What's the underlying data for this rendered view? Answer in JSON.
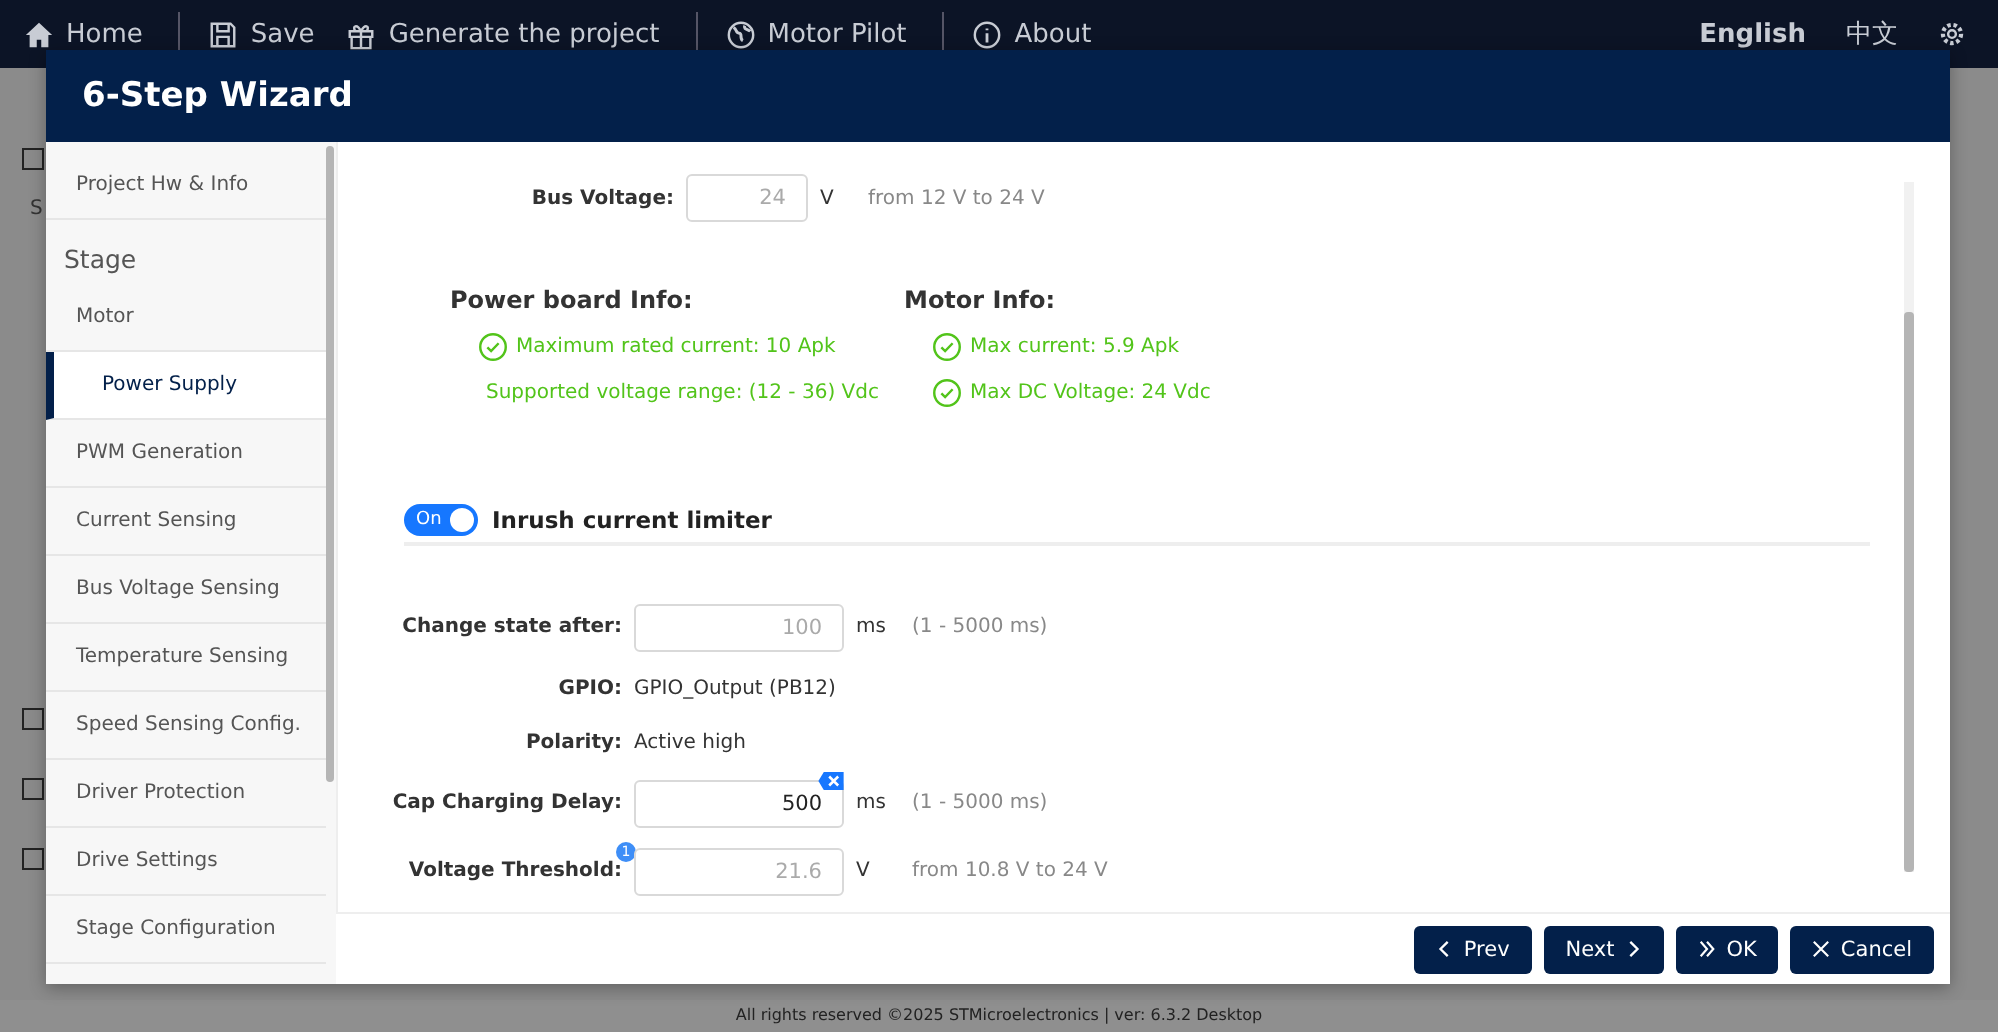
{
  "nav": {
    "items": [
      {
        "label": "Home"
      },
      {
        "label": "Save"
      },
      {
        "label": "Generate the project"
      },
      {
        "label": "Motor Pilot"
      },
      {
        "label": "About"
      }
    ],
    "languages": [
      {
        "label": "English",
        "selected": true
      },
      {
        "label": "中文",
        "selected": false
      }
    ]
  },
  "background": {
    "section": "S",
    "checkboxes": [
      {
        "checked": false
      },
      {
        "checked": false
      },
      {
        "checked": false
      },
      {
        "checked": false
      }
    ]
  },
  "footer": "All rights reserved ©2025 STMicroelectronics | ver: 6.3.2 Desktop",
  "wizard": {
    "title": "6-Step Wizard",
    "sidebar": [
      {
        "kind": "item",
        "label": "Project Hw & Info",
        "selected": false
      },
      {
        "kind": "heading",
        "label": "Stage"
      },
      {
        "kind": "item",
        "label": "Motor",
        "selected": false
      },
      {
        "kind": "item",
        "label": "Power Supply",
        "selected": true
      },
      {
        "kind": "item",
        "label": "PWM Generation",
        "selected": false
      },
      {
        "kind": "item",
        "label": "Current Sensing",
        "selected": false
      },
      {
        "kind": "item",
        "label": "Bus Voltage Sensing",
        "selected": false
      },
      {
        "kind": "item",
        "label": "Temperature Sensing",
        "selected": false
      },
      {
        "kind": "item",
        "label": "Speed Sensing Config.",
        "selected": false
      },
      {
        "kind": "item",
        "label": "Driver Protection",
        "selected": false
      },
      {
        "kind": "item",
        "label": "Drive Settings",
        "selected": false
      },
      {
        "kind": "item",
        "label": "Stage Configuration",
        "selected": false
      }
    ],
    "bus_voltage": {
      "label": "Bus Voltage:",
      "value": "24",
      "unit": "V",
      "hint": "from 12 V to 24 V",
      "disabled": true
    },
    "info_groups": [
      {
        "title": "Power board Info:",
        "items": [
          "Maximum rated current: 10 Apk",
          "Supported voltage range: (12 - 36) Vdc"
        ]
      },
      {
        "title": "Motor Info:",
        "items": [
          "Max current: 5.9 Apk",
          "Max DC Voltage: 24 Vdc"
        ]
      }
    ],
    "inrush": {
      "on": true,
      "toggle_label": "On",
      "title": "Inrush current limiter"
    },
    "fields": [
      {
        "kind": "input",
        "label": "Change state after:",
        "value": "100",
        "unit": "ms",
        "hint": "(1 - 5000 ms)",
        "disabled": true
      },
      {
        "kind": "text",
        "label": "GPIO:",
        "value": "GPIO_Output (PB12)"
      },
      {
        "kind": "text",
        "label": "Polarity:",
        "value": "Active high"
      },
      {
        "kind": "input",
        "label": "Cap Charging Delay:",
        "value": "500",
        "unit": "ms",
        "hint": "(1 - 5000 ms)",
        "disabled": false,
        "clearable": true
      },
      {
        "kind": "input",
        "label": "Voltage Threshold:",
        "value": "21.6",
        "unit": "V",
        "hint": "from 10.8 V to 24 V",
        "disabled": true,
        "badge": "1"
      }
    ],
    "buttons": [
      {
        "label": "Prev"
      },
      {
        "label": "Next"
      },
      {
        "label": "OK"
      },
      {
        "label": "Cancel"
      }
    ]
  }
}
